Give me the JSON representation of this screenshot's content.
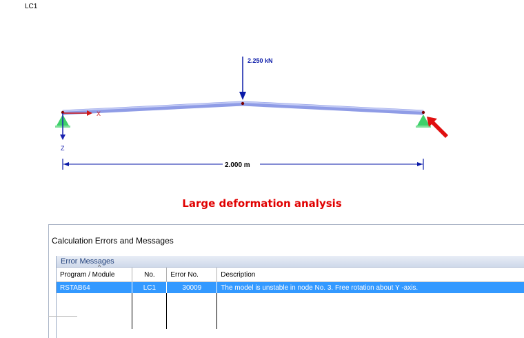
{
  "load_case": "LC1",
  "model": {
    "load_value": "2.250 kN",
    "dimension": "2.000 m",
    "axis_x": "X",
    "axis_z": "Z"
  },
  "heading": "Large deformation analysis",
  "dialog": {
    "title": "Calculation Errors and Messages",
    "group_title": "Error Messages",
    "columns": [
      "Program / Module",
      "No.",
      "Error No.",
      "Description"
    ],
    "rows": [
      {
        "module": "RSTAB64",
        "no": "LC1",
        "error_no": "30009",
        "description": "The model is unstable in node No. 3. Free rotation about Y -axis."
      }
    ],
    "selected_row": 0
  },
  "colors": {
    "member": "#9aa6ea",
    "dimension": "#0a1aa8",
    "heading": "#e00000",
    "support": "#3ed06a",
    "highlight_arrow": "#e01010",
    "selection": "#3399ff"
  }
}
